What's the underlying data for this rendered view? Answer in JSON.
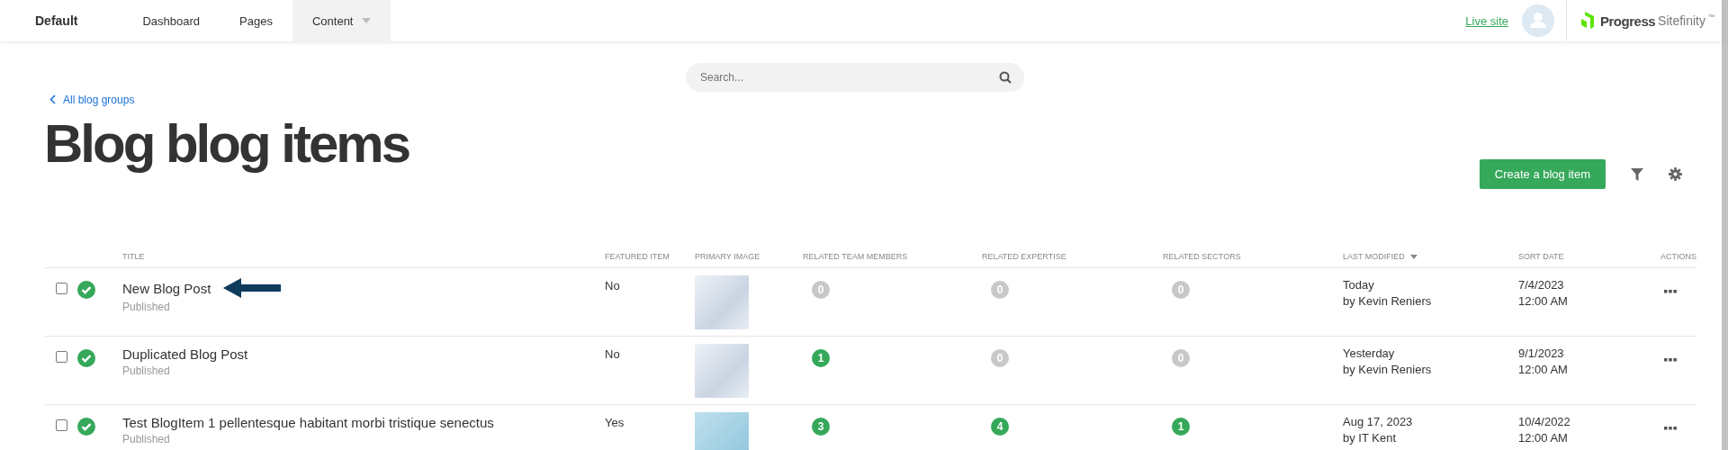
{
  "topbar": {
    "site": "Default",
    "nav": [
      {
        "label": "Dashboard",
        "selected": false,
        "dropdown": false
      },
      {
        "label": "Pages",
        "selected": false,
        "dropdown": false
      },
      {
        "label": "Content",
        "selected": true,
        "dropdown": true
      }
    ],
    "live_site": "Live site",
    "logo": {
      "name": "Progress",
      "product": "Sitefinity",
      "mark": "™"
    }
  },
  "search": {
    "placeholder": "Search..."
  },
  "back_link": "All blog groups",
  "title": "Blog blog items",
  "create_button": "Create a blog item",
  "table": {
    "columns": [
      {
        "label": "TITLE",
        "sorted": false
      },
      {
        "label": "FEATURED ITEM",
        "sorted": false
      },
      {
        "label": "PRIMARY IMAGE",
        "sorted": false
      },
      {
        "label": "RELATED TEAM MEMBERS",
        "sorted": false
      },
      {
        "label": "RELATED EXPERTISE",
        "sorted": false
      },
      {
        "label": "RELATED SECTORS",
        "sorted": false
      },
      {
        "label": "LAST MODIFIED",
        "sorted": true
      },
      {
        "label": "SORT DATE",
        "sorted": false
      },
      {
        "label": "ACTIONS",
        "sorted": false
      }
    ],
    "rows": [
      {
        "checked": false,
        "title": "New Blog Post",
        "status": "Published",
        "arrow": true,
        "featured": "No",
        "related": [
          {
            "count": "0",
            "color": "#c8c8c8"
          },
          {
            "count": "0",
            "color": "#c8c8c8"
          },
          {
            "count": "0",
            "color": "#c8c8c8"
          }
        ],
        "modified": "Today",
        "modified_by": "by Kevin Reniers",
        "sort_date": "7/4/2023",
        "sort_time": "12:00 AM"
      },
      {
        "checked": false,
        "title": "Duplicated Blog Post",
        "status": "Published",
        "arrow": false,
        "featured": "No",
        "related": [
          {
            "count": "1",
            "color": "#35a85a"
          },
          {
            "count": "0",
            "color": "#c8c8c8"
          },
          {
            "count": "0",
            "color": "#c8c8c8"
          }
        ],
        "modified": "Yesterday",
        "modified_by": "by Kevin Reniers",
        "sort_date": "9/1/2023",
        "sort_time": "12:00 AM"
      },
      {
        "checked": false,
        "title": "Test BlogItem 1 pellentesque habitant morbi tristique senectus",
        "status": "Published",
        "arrow": false,
        "featured": "Yes",
        "related": [
          {
            "count": "3",
            "color": "#35a85a"
          },
          {
            "count": "4",
            "color": "#35a85a"
          },
          {
            "count": "1",
            "color": "#35a85a"
          }
        ],
        "modified": "Aug 17, 2023",
        "modified_by": "by IT Kent",
        "sort_date": "10/4/2022",
        "sort_time": "12:00 AM"
      }
    ]
  }
}
